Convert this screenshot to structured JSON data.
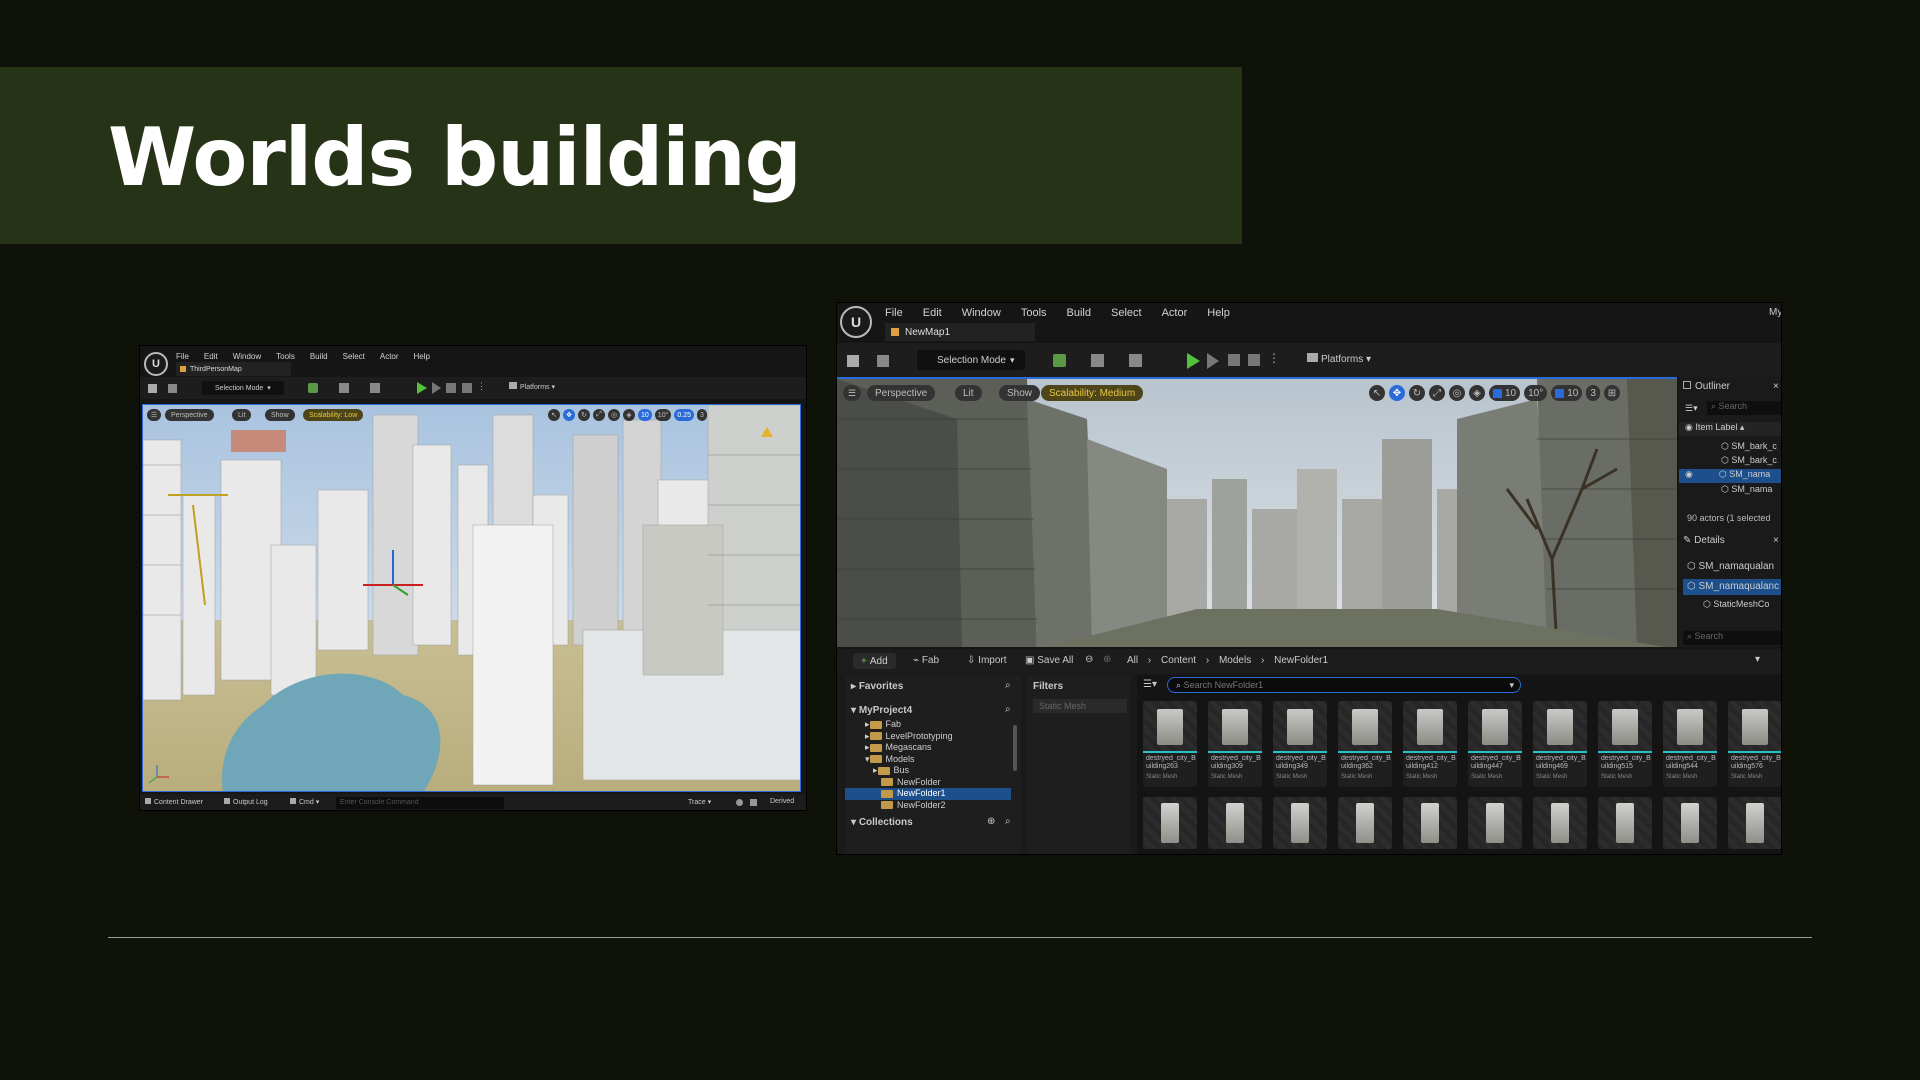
{
  "slide": {
    "title": "Worlds building"
  },
  "left_editor": {
    "menu": [
      "File",
      "Edit",
      "Window",
      "Tools",
      "Build",
      "Select",
      "Actor",
      "Help"
    ],
    "map_tab": "ThirdPersonMap",
    "selection_mode": "Selection Mode",
    "platforms": "Platforms",
    "viewport": {
      "perspective": "Perspective",
      "lit": "Lit",
      "show": "Show",
      "scalability": "Scalability: Low",
      "grid": "10",
      "angle": "10°",
      "scale": "0.25",
      "camera": "3"
    },
    "status_bar": {
      "content_drawer": "Content Drawer",
      "output_log": "Output Log",
      "cmd": "Cmd",
      "console_placeholder": "Enter Console Command",
      "trace": "Trace",
      "derived": "Derived"
    }
  },
  "right_editor": {
    "menu": [
      "File",
      "Edit",
      "Window",
      "Tools",
      "Build",
      "Select",
      "Actor",
      "Help"
    ],
    "corner_text": "My",
    "map_tab": "NewMap1",
    "selection_mode": "Selection Mode",
    "platforms": "Platforms",
    "viewport": {
      "perspective": "Perspective",
      "lit": "Lit",
      "show": "Show",
      "scalability": "Scalability: Medium",
      "grid": "10",
      "angle": "10°",
      "scale": "10",
      "camera": "3"
    },
    "outliner": {
      "title": "Outliner",
      "search": "Search",
      "column": "Item Label",
      "items": [
        "SM_bark_c",
        "SM_bark_c",
        "SM_nama",
        "SM_nama"
      ],
      "footer": "90 actors (1 selected"
    },
    "details": {
      "title": "Details",
      "item1": "SM_namaqualan",
      "item2": "SM_namaqualanc",
      "item3": "StaticMeshCo",
      "search": "Search"
    },
    "content_browser": {
      "add": "Add",
      "fab": "Fab",
      "import": "Import",
      "save_all": "Save All",
      "breadcrumb": [
        "All",
        "Content",
        "Models",
        "NewFolder1"
      ],
      "favorites": "Favorites",
      "project": "MyProject4",
      "tree": [
        {
          "label": "Fab",
          "depth": 1
        },
        {
          "label": "LevelPrototyping",
          "depth": 1
        },
        {
          "label": "Megascans",
          "depth": 1
        },
        {
          "label": "Models",
          "depth": 1
        },
        {
          "label": "Bus",
          "depth": 2
        },
        {
          "label": "NewFolder",
          "depth": 2
        },
        {
          "label": "NewFolder1",
          "depth": 2
        },
        {
          "label": "NewFolder2",
          "depth": 2
        }
      ],
      "collections": "Collections",
      "filters": "Filters",
      "filter_chip": "Static Mesh",
      "search_placeholder": "Search NewFolder1",
      "asset_type": "Static Mesh",
      "assets": [
        "destryed_city_Building263",
        "destryed_city_Building309",
        "destryed_city_Building349",
        "destryed_city_Building362",
        "destryed_city_Building412",
        "destryed_city_Building447",
        "destryed_city_Building469",
        "destryed_city_Building515",
        "destryed_city_Building544",
        "destryed_city_Building576"
      ]
    }
  }
}
